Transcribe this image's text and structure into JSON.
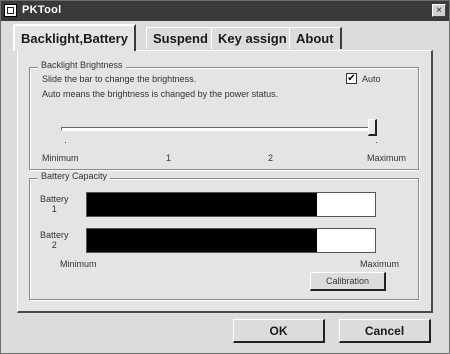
{
  "window": {
    "title": "PKTool",
    "close_glyph": "×"
  },
  "tabs": [
    {
      "label": "Backlight,Battery",
      "active": true
    },
    {
      "label": "Suspend",
      "active": false
    },
    {
      "label": "Key assign",
      "active": false
    },
    {
      "label": "About",
      "active": false
    }
  ],
  "backlight": {
    "group_title": "Backlight Brightness",
    "instruction": "Slide the bar to change the brightness.",
    "auto_note": "Auto means the brightness is changed by the power status.",
    "auto_label": "Auto",
    "auto_checked": true,
    "auto_check_glyph": "✔",
    "level": 3,
    "level_max": 3,
    "tick_min": "·",
    "tick_max": "·",
    "scale_labels": [
      "Minimum",
      "1",
      "2",
      "Maximum"
    ]
  },
  "battery": {
    "group_title": "Battery Capacity",
    "batteries": [
      {
        "label_line1": "Battery",
        "label_line2": "1",
        "level": 0.8
      },
      {
        "label_line1": "Battery",
        "label_line2": "2",
        "level": 0.8
      }
    ],
    "min_label": "Minimum",
    "max_label": "Maximum",
    "calibration_label": "Calibration"
  },
  "buttons": {
    "ok_label": "OK",
    "cancel_label": "Cancel"
  },
  "colors": {
    "title_bar": "#3a3a3a",
    "dialog_face": "#dcdcdc",
    "battery_fill": "#000000"
  }
}
